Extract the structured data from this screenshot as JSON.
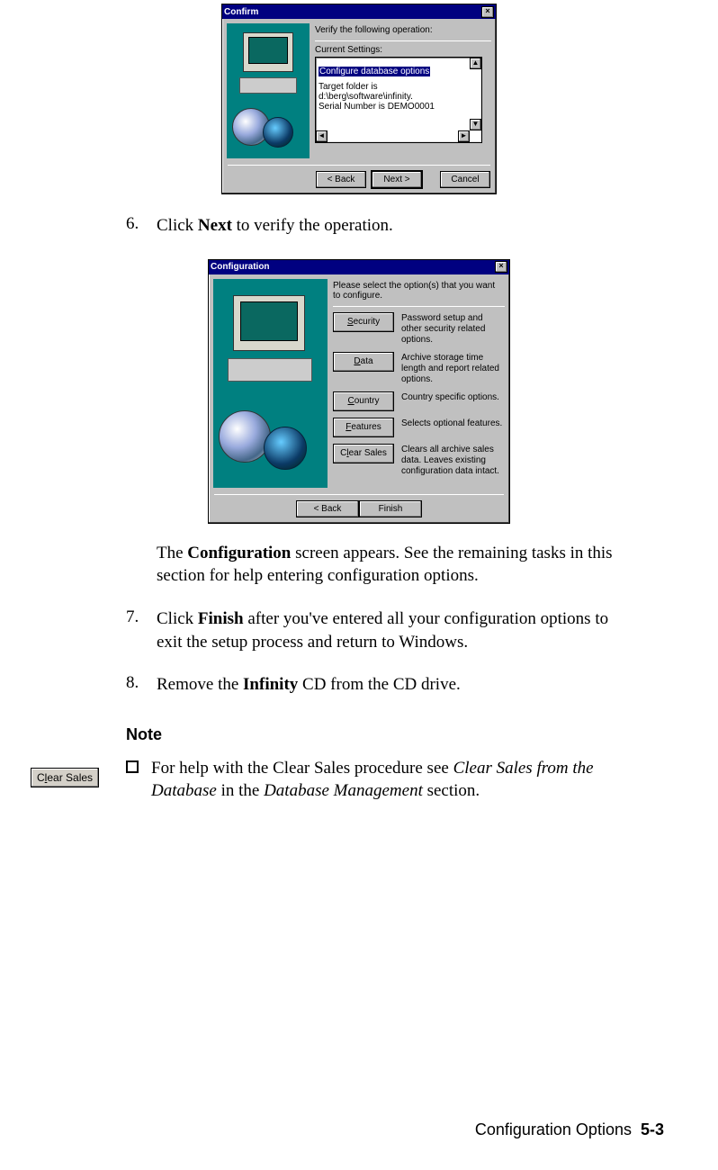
{
  "dialog1": {
    "title": "Confirm",
    "heading": "Verify the following operation:",
    "settings_label": "Current Settings:",
    "settings_line1": "Configure database options",
    "settings_line2": "Target folder is d:\\berg\\software\\infinity.",
    "settings_line3": "Serial Number is DEMO0001",
    "back_btn": "< Back",
    "next_btn": "Next >",
    "cancel_btn": "Cancel"
  },
  "step6": {
    "num": "6.",
    "text_pre": "Click ",
    "text_bold": "Next",
    "text_post": " to verify the operation."
  },
  "dialog2": {
    "title": "Configuration",
    "heading": "Please select the option(s) that you want to configure.",
    "options": [
      {
        "label": "Security",
        "ul_index": 0,
        "desc": "Password setup and other security related options."
      },
      {
        "label": "Data",
        "ul_index": 0,
        "desc": "Archive storage time length and report related options."
      },
      {
        "label": "Country",
        "ul_index": 0,
        "desc": "Country specific options."
      },
      {
        "label": "Features",
        "ul_index": 0,
        "desc": "Selects optional features."
      },
      {
        "label": "Clear Sales",
        "ul_index": 1,
        "desc": "Clears all archive sales data. Leaves existing configuration data intact."
      }
    ],
    "back_btn": "< Back",
    "finish_btn": "Finish"
  },
  "para_after_dlg2": {
    "pre": "The ",
    "bold": "Configuration",
    "post": " screen appears. See the remaining tasks in this section for help entering configuration options."
  },
  "step7": {
    "num": "7.",
    "pre": "Click ",
    "bold": "Finish",
    "post": " after you've entered all your configuration options to exit the setup process and return to Windows."
  },
  "step8": {
    "num": "8.",
    "pre": "Remove the ",
    "bold": "Infinity",
    "post": " CD from the CD drive."
  },
  "note_heading": "Note",
  "margin_button": "Clear Sales",
  "note_bullet": {
    "pre": "For help with the Clear Sales procedure see ",
    "it1": "Clear Sales from the Database",
    "mid": " in the ",
    "it2": "Database Management",
    "post": " section."
  },
  "footer": {
    "label": "Configuration Options",
    "page": "5-3"
  }
}
